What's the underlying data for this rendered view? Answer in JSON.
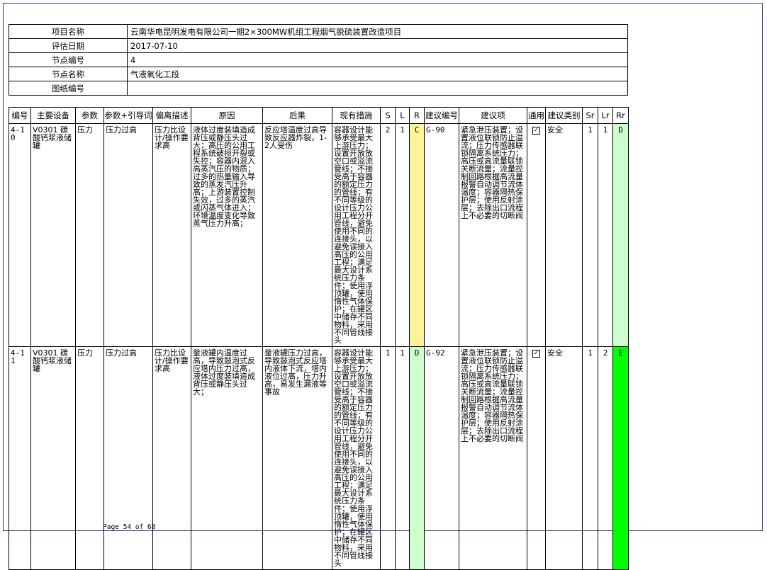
{
  "info": {
    "project_name_label": "项目名称",
    "project_name": "云南华电昆明发电有限公司一期2×300MW机组工程烟气脱硫装置改造项目",
    "eval_date_label": "评估日期",
    "eval_date": "2017-07-10",
    "node_no_label": "节点编号",
    "node_no": "4",
    "node_name_label": "节点名称",
    "node_name": "气液氧化工段",
    "drawing_no_label": "图纸编号",
    "drawing_no": ""
  },
  "table": {
    "headers": [
      "编号",
      "主要设备",
      "参数",
      "参数+引导词",
      "偏离描述",
      "原因",
      "后果",
      "现有措施",
      "S",
      "L",
      "R",
      "建议编号",
      "建议项",
      "通用",
      "建议类别",
      "Sr",
      "Lr",
      "Rr"
    ],
    "rows": [
      {
        "id": "4-10",
        "equipment": "V0301 碳酸钙浆液储罐",
        "param": "压力",
        "param_guide": "压力过高",
        "deviation": "压力比设计/操作要求高",
        "cause": "液体过度装填造成背压或静压头过大；高压的公用工程系统破损开裂或失控；容器内混入高蒸汽压的物质；过多的热量输入导致的蒸发汽压升高；上游装置控制失效，过多的蒸汽或闪蒸气体进入；环境温度变化导致蒸气压力升高；",
        "consequence": "反应塔温度过高导致反应器炸裂，1-2人受伤",
        "measures": "容器设计能够承受最大上游压力；设置开放放空口或溢流管线；不接受高于容器的额定压力的管线；有不同等级的设计压力公用工程分开管线，避免使用不同的连接头，以避免误接入高压的公用工程；满足最大设计系统压力条件；使用浮顶罐，使用惰性气体保护；在罐区中储存不同物料，采用不同管线接头",
        "s": "2",
        "l": "1",
        "r": "C",
        "r_color": "#fdf39a",
        "rec_no": "G-90",
        "recommendation": "紧急泄压装置；设置液位联锁防止溢流；压力传感器联锁隔离系统压力；高压或高流量联锁关断流量；流量控制回路根据高流量报警自动调节流体温度；容器隔热保护层；使用反射涂层；去除出口流程上不必要的切断阀",
        "general": "✓",
        "category": "安全",
        "sr": "1",
        "lr": "1",
        "rr": "D",
        "rr_color": "#ccffcc"
      },
      {
        "id": "4-11",
        "equipment": "V0301 碳酸钙浆液储罐",
        "param": "压力",
        "param_guide": "压力过高",
        "deviation": "压力比设计/操作要求高",
        "cause": "釜液罐内温度过高，导致鼓泡式反应塔内压力过高，液体过度装填造成背压或静压头过大；",
        "consequence": "釜液罐压力过高，导致鼓泡式反应塔内液体下流，塔内液位过高，压力升高，易发生漏液等事故",
        "measures": "容器设计能够承受最大上游压力；设置开放放空口或溢流管线；不接受高于容器的额定压力的管线；有不同等级的设计压力公用工程分开管线，避免使用不同的连接头，以避免误接入高压的公用工程；满足最大设计系统压力条件；使用浮顶罐，使用惰性气体保护；在罐区中储存不同物料，采用不同管线接头",
        "s": "1",
        "l": "1",
        "r": "D",
        "r_color": "#ccffcc",
        "rec_no": "G-92",
        "recommendation": "紧急泄压装置；设置液位联锁防止溢流；压力传感器联锁隔离系统压力；高压或高流量联锁关断流量；流量控制回路根据高流量报警自动调节流体温度；容器隔热保护层；使用反射涂层；去除出口流程上不必要的切断阀",
        "general": "✓",
        "category": "安全",
        "sr": "1",
        "lr": "2",
        "rr": "E",
        "rr_color": "#00ff00"
      }
    ]
  },
  "footer": {
    "page_text": "Page 54 of 68"
  }
}
